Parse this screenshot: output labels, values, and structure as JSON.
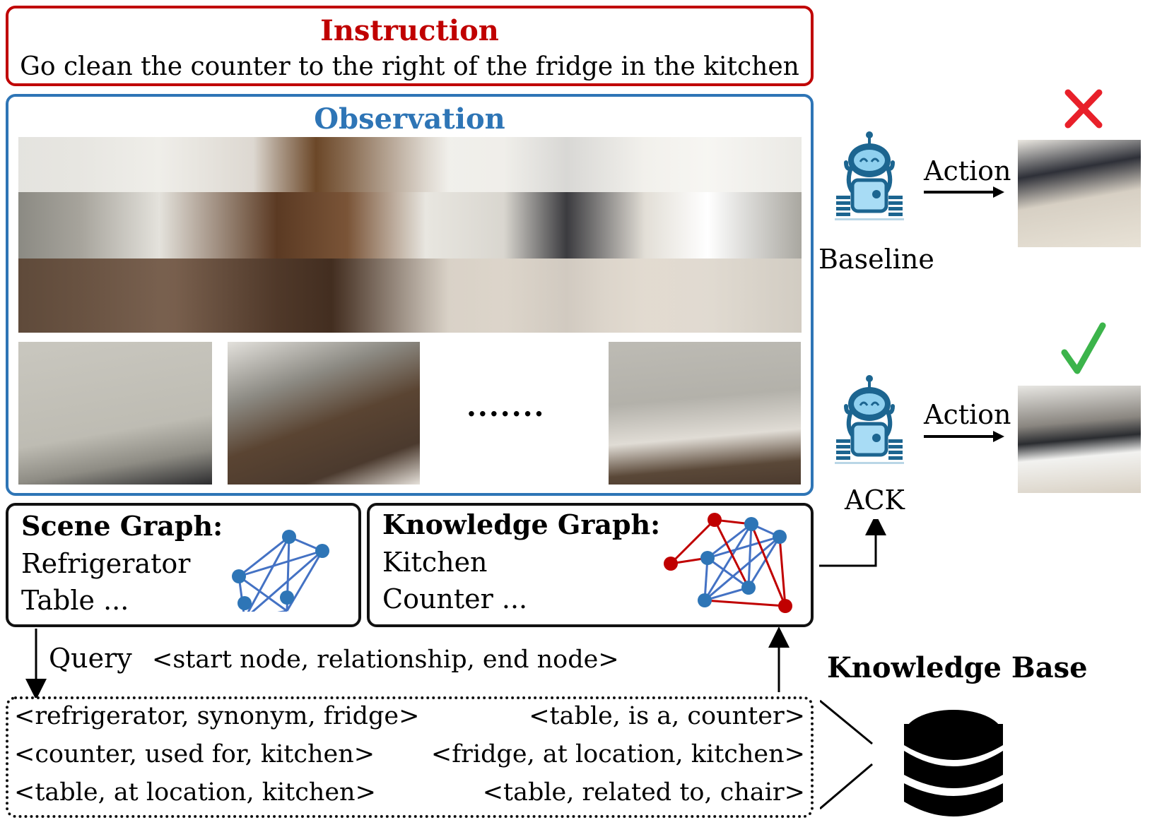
{
  "instruction": {
    "title": "Instruction",
    "text": "Go clean the counter to the right of the fridge in the kitchen"
  },
  "observation": {
    "title": "Observation",
    "panorama": "panoramic-living-kitchen-image",
    "views": [
      "view-ceiling-corner",
      "view-dining-table",
      "view-dining-floor"
    ],
    "ellipsis": "......."
  },
  "scene_graph": {
    "title": "Scene Graph:",
    "items": [
      "Refrigerator",
      "Table ..."
    ]
  },
  "knowledge_graph": {
    "title": "Knowledge Graph:",
    "items": [
      "Kitchen",
      "Counter ..."
    ]
  },
  "query": {
    "label": "Query",
    "format": "<start node, relationship, end node>"
  },
  "knowledge_base": {
    "title": "Knowledge Base",
    "triples_left": [
      "<refrigerator, synonym, fridge>",
      "<counter, used for, kitchen>",
      "<table, at location, kitchen>"
    ],
    "triples_right": [
      "<table, is a, counter>",
      "<fridge, at location, kitchen>",
      "<table, related to, chair>"
    ]
  },
  "agents": {
    "baseline": {
      "label": "Baseline",
      "action": "Action",
      "outcome": "cross-mark-icon"
    },
    "ack": {
      "label": "ACK",
      "action": "Action",
      "outcome": "check-mark-icon"
    }
  },
  "colors": {
    "instruction": "#c00000",
    "observation": "#2e75b6",
    "graph_node_blue": "#2e75b6",
    "graph_node_red": "#c00000",
    "cross": "#e8202a",
    "check": "#3cb44b",
    "robot": "#1c6590"
  }
}
